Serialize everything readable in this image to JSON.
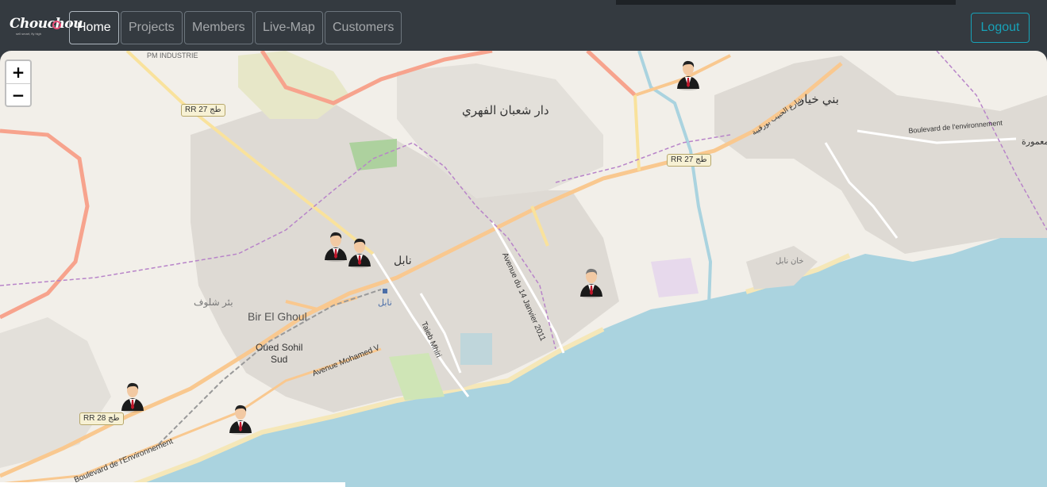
{
  "app": {
    "brand": "Chouchou",
    "brand_sub": "sell smart, fly high"
  },
  "nav": {
    "home": "Home",
    "projects": "Projects",
    "members": "Members",
    "live_map": "Live-Map",
    "customers": "Customers",
    "logout": "Logout"
  },
  "map": {
    "zoom_in": "+",
    "zoom_out": "−",
    "labels": {
      "pm_industrie": "PM INDUSTRIE",
      "dar_chaabane": "دار شعبان الفهري",
      "beni_khiar": "بني خيار",
      "nabeul": "نابل",
      "nabeul_station": "نابل",
      "bir_chalouf": "بئر شلوف",
      "bir_el_ghoul": "Bir El Ghoul",
      "oued_sohil": "Oued Sohil",
      "sud": "Sud",
      "avenue_mohamed_v": "Avenue Mohamed V",
      "avenue_14_janvier": "Avenue du 14 Janvier 2011",
      "taieb_mhiri": "Taieb Mhiri",
      "boulevard_env_right": "Boulevard de l'environnement",
      "boulevard_env_left": "Boulevard de l'Environnement",
      "khan_nabeul": "خان نابل",
      "mamoura": "المعمورة",
      "habib_bourguiba": "شارع الحبيب بورقيبة"
    },
    "shields": {
      "rr27_left": "RR 27 طج",
      "rr27_right": "RR 27 طج",
      "rr28": "RR 28 طج"
    },
    "colors": {
      "land": "#f2efe9",
      "sea": "#aad3df",
      "urban": "#dedad4",
      "primary_road": "#f9c88f",
      "trunk_road": "#f7a38d",
      "beach": "#f5e7b8",
      "boundary": "#b884c9"
    },
    "markers": [
      {
        "name": "member-1",
        "icon": "person-suit-icon"
      },
      {
        "name": "member-2",
        "icon": "person-suit-icon"
      },
      {
        "name": "member-3",
        "icon": "person-suit-icon"
      },
      {
        "name": "member-4",
        "icon": "person-suit-icon"
      },
      {
        "name": "member-5",
        "icon": "person-suit-icon"
      },
      {
        "name": "member-6",
        "icon": "person-suit-icon"
      }
    ]
  }
}
